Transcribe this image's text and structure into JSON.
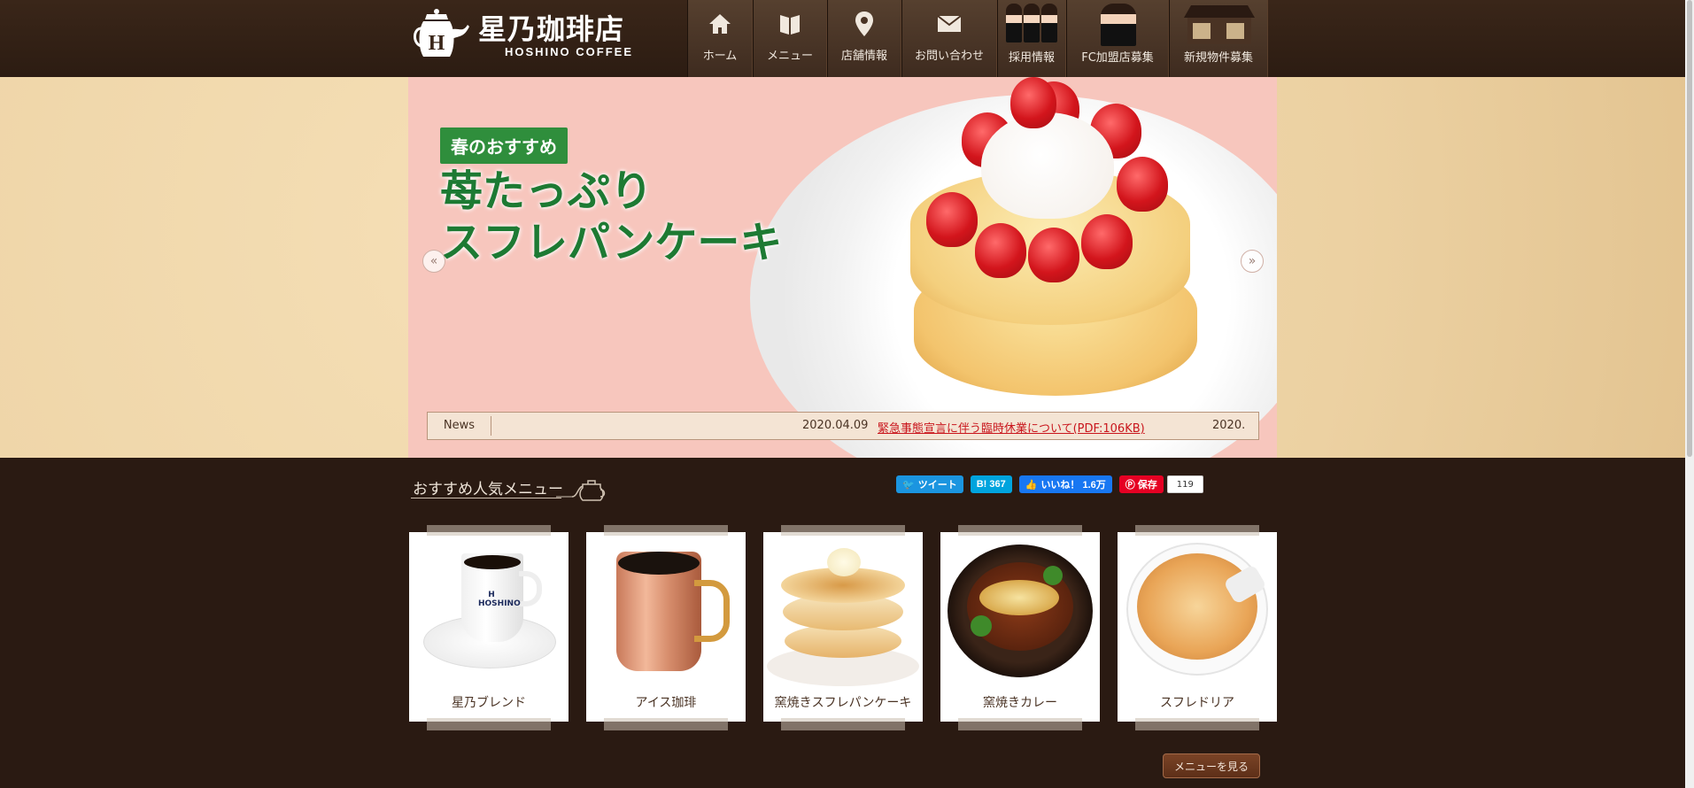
{
  "header": {
    "logo_jp": "星乃珈琲店",
    "logo_en": "HOSHINO COFFEE",
    "nav": [
      {
        "label": "ホーム",
        "icon": "home-icon"
      },
      {
        "label": "メニュー",
        "icon": "book-icon"
      },
      {
        "label": "店舗情報",
        "icon": "map-pin-icon"
      },
      {
        "label": "お問い合わせ",
        "icon": "mail-icon"
      },
      {
        "label": "採用情報",
        "icon": "staff-photo"
      },
      {
        "label": "FC加盟店募集",
        "icon": "owner-photo"
      },
      {
        "label": "新規物件募集",
        "icon": "store-photo"
      }
    ]
  },
  "hero": {
    "tag": "春のおすすめ",
    "title_line1": "苺たっぷり",
    "title_line2": "スフレパンケーキ",
    "prev": "«",
    "next": "»",
    "news": {
      "label": "News",
      "date": "2020.04.09",
      "link_text": "緊急事態宣言に伴う臨時休業について(PDF:106KB)",
      "next_date": "2020."
    }
  },
  "recommend": {
    "title": "おすすめ人気メニュー",
    "items": [
      {
        "name": "星乃ブレンド"
      },
      {
        "name": "アイス珈琲"
      },
      {
        "name": "窯焼きスフレパンケーキ"
      },
      {
        "name": "窯焼きカレー"
      },
      {
        "name": "スフレドリア"
      }
    ],
    "more_button": "メニューを見る"
  },
  "social": {
    "tweet": "ツイート",
    "hatena": "B! 367",
    "like": "いいね！ 1.6万",
    "pin": "保存",
    "pin_count": "119"
  },
  "colors": {
    "header_bg": "#3a2619",
    "body_bg": "#2a1a12",
    "hero_pink": "#f7c6bd",
    "accent_green": "#2f8e3c",
    "title_green": "#1d7a33",
    "news_red": "#c9161d"
  }
}
